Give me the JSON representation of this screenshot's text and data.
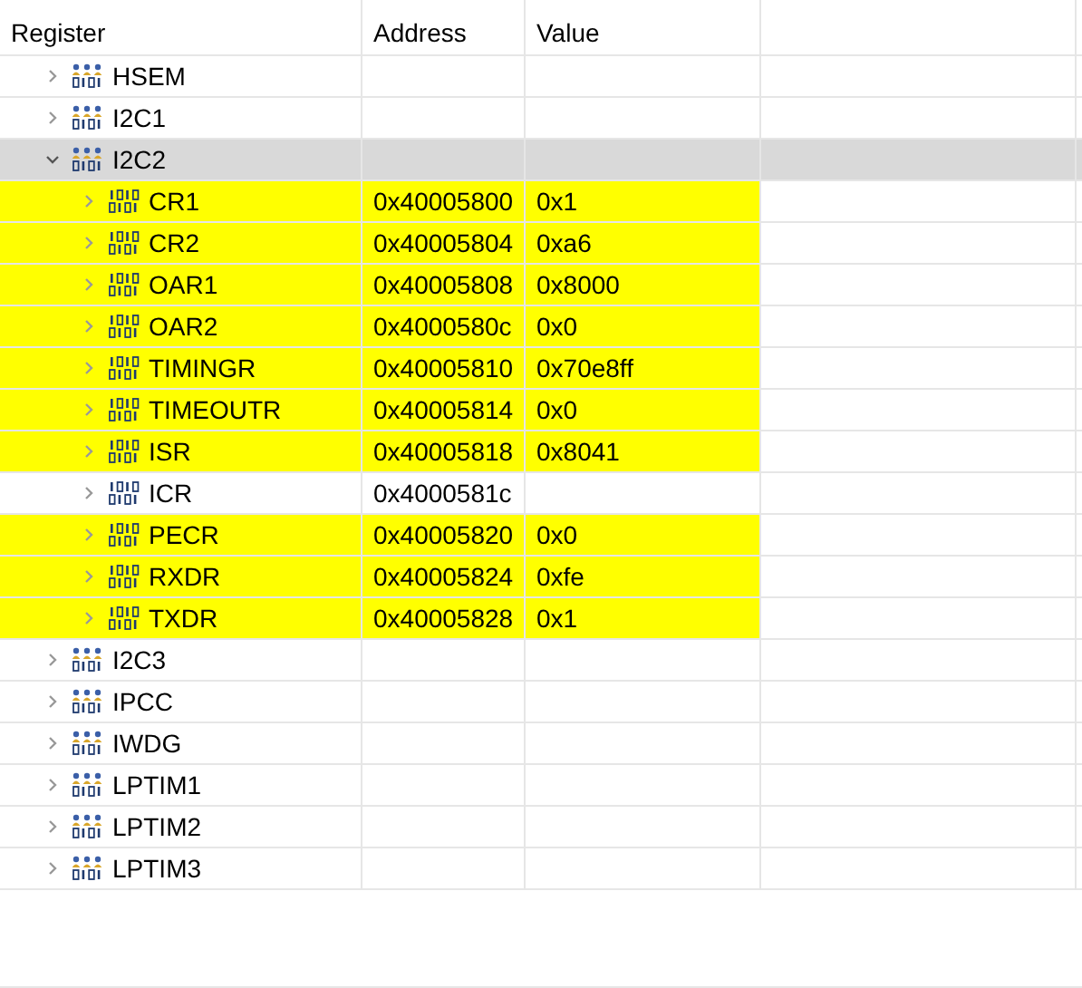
{
  "columns": [
    "Register",
    "Address",
    "Value"
  ],
  "rows": [
    {
      "kind": "peripheral",
      "name": "HSEM",
      "expanded": false,
      "selected": false
    },
    {
      "kind": "peripheral",
      "name": "I2C1",
      "expanded": false,
      "selected": false
    },
    {
      "kind": "peripheral",
      "name": "I2C2",
      "expanded": true,
      "selected": true,
      "children": [
        {
          "kind": "register",
          "name": "CR1",
          "address": "0x40005800",
          "value": "0x1",
          "expanded": false,
          "selected": false,
          "changed": true
        },
        {
          "kind": "register",
          "name": "CR2",
          "address": "0x40005804",
          "value": "0xa6",
          "expanded": false,
          "selected": false,
          "changed": true
        },
        {
          "kind": "register",
          "name": "OAR1",
          "address": "0x40005808",
          "value": "0x8000",
          "expanded": false,
          "selected": false,
          "changed": true
        },
        {
          "kind": "register",
          "name": "OAR2",
          "address": "0x4000580c",
          "value": "0x0",
          "expanded": false,
          "selected": false,
          "changed": true
        },
        {
          "kind": "register",
          "name": "TIMINGR",
          "address": "0x40005810",
          "value": "0x70e8ff",
          "expanded": false,
          "selected": false,
          "changed": true
        },
        {
          "kind": "register",
          "name": "TIMEOUTR",
          "address": "0x40005814",
          "value": "0x0",
          "expanded": false,
          "selected": false,
          "changed": true
        },
        {
          "kind": "register",
          "name": "ISR",
          "address": "0x40005818",
          "value": "0x8041",
          "expanded": false,
          "selected": false,
          "changed": true
        },
        {
          "kind": "register",
          "name": "ICR",
          "address": "0x4000581c",
          "expanded": false,
          "selected": false,
          "changed": false
        },
        {
          "kind": "register",
          "name": "PECR",
          "address": "0x40005820",
          "value": "0x0",
          "expanded": false,
          "selected": false,
          "changed": true
        },
        {
          "kind": "register",
          "name": "RXDR",
          "address": "0x40005824",
          "value": "0xfe",
          "expanded": false,
          "selected": false,
          "changed": true
        },
        {
          "kind": "register",
          "name": "TXDR",
          "address": "0x40005828",
          "value": "0x1",
          "expanded": false,
          "selected": false,
          "changed": true
        }
      ]
    },
    {
      "kind": "peripheral",
      "name": "I2C3",
      "expanded": false,
      "selected": false
    },
    {
      "kind": "peripheral",
      "name": "IPCC",
      "expanded": false,
      "selected": false
    },
    {
      "kind": "peripheral",
      "name": "IWDG",
      "expanded": false,
      "selected": false
    },
    {
      "kind": "peripheral",
      "name": "LPTIM1",
      "expanded": false,
      "selected": false
    },
    {
      "kind": "peripheral",
      "name": "LPTIM2",
      "expanded": false,
      "selected": false
    },
    {
      "kind": "peripheral",
      "name": "LPTIM3",
      "expanded": false,
      "selected": false
    }
  ]
}
